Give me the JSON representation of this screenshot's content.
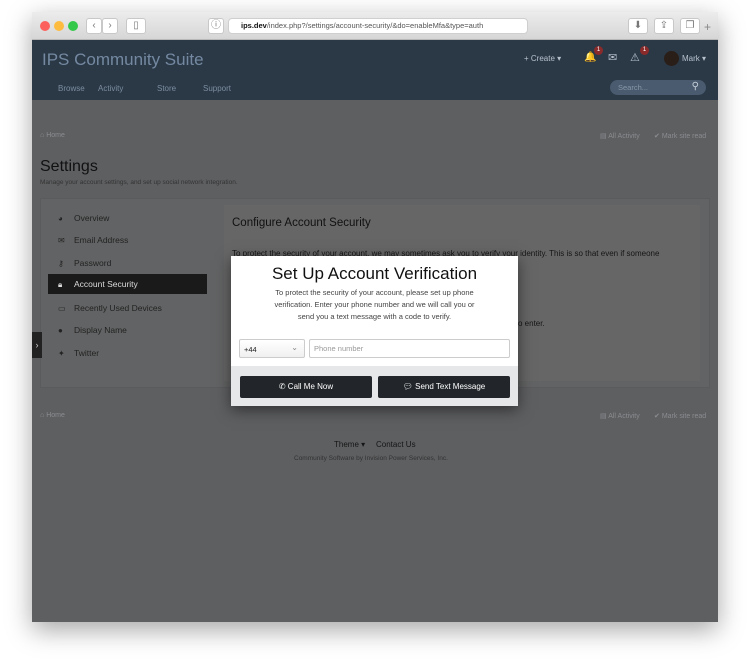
{
  "browser": {
    "url_host": "ips.dev",
    "url_path": "/index.php?/settings/account-security/&do=enableMfa&type=auth"
  },
  "header": {
    "brand": "IPS Community Suite",
    "create": "+ Create ▾",
    "notifications_count": "1",
    "reports_count": "1",
    "user": "Mark ▾",
    "nav": [
      "Browse",
      "Activity",
      "Store",
      "Support"
    ],
    "search_placeholder": "Search..."
  },
  "breadcrumb": {
    "home": "Home",
    "all_activity": "All Activity",
    "mark_read": "Mark site read"
  },
  "page": {
    "title": "Settings",
    "subtitle": "Manage your account settings, and set up social network integration."
  },
  "sidebar": {
    "items": [
      {
        "label": "Overview",
        "icon": "dashboard-icon"
      },
      {
        "label": "Email Address",
        "icon": "envelope-icon"
      },
      {
        "label": "Password",
        "icon": "key-icon"
      },
      {
        "label": "Account Security",
        "icon": "lock-icon",
        "active": true
      },
      {
        "label": "Recently Used Devices",
        "icon": "laptop-icon"
      },
      {
        "label": "Display Name",
        "icon": "user-icon"
      },
      {
        "label": "Twitter",
        "icon": "twitter-icon"
      }
    ]
  },
  "content": {
    "title": "Configure Account Security",
    "text": "To protect the security of your account, we may sometimes ask you to verify your identity. This is so that even if someone",
    "text2": "o enter."
  },
  "modal": {
    "title": "Set Up Account Verification",
    "description": "To protect the security of your account, please set up phone verification. Enter your phone number and we will call you or send you a text message with a code to verify.",
    "country_code": "+44",
    "phone_placeholder": "Phone number",
    "call_button": "Call Me Now",
    "text_button": "Send Text Message"
  },
  "footer": {
    "theme": "Theme ▾",
    "contact": "Contact Us",
    "copyright": "Community Software by Invision Power Services, Inc."
  }
}
